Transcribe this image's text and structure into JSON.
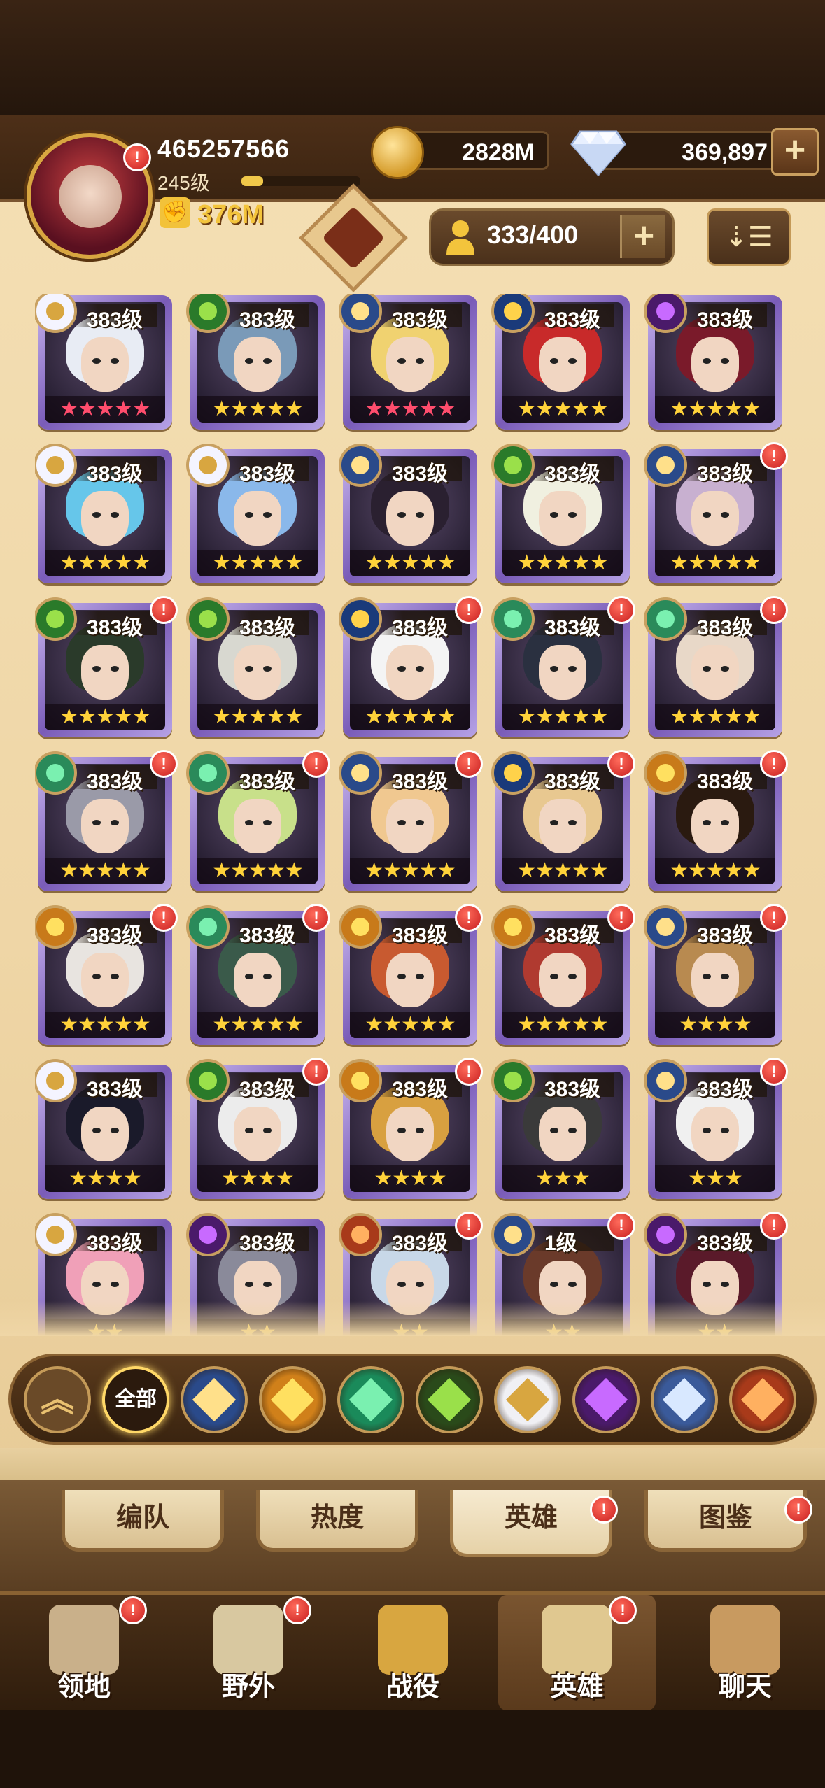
{
  "player": {
    "id": "465257566",
    "level": "245级",
    "xp_progress": 0.18,
    "power": "376M",
    "avatar_badge": "!"
  },
  "currency": {
    "gold": "2828M",
    "diamonds": "369,897",
    "add_symbol": "+"
  },
  "heroes_count": "333/400",
  "sort_symbol": "⇣☰",
  "colors": {
    "frame_purple": "#7a5cb8",
    "gold": "#f3c43c",
    "red_badge": "#d62828",
    "panel": "#f0dab0"
  },
  "heroes": [
    {
      "level": "383级",
      "stars": "★★★★★",
      "star_color": "#ff4d6d",
      "faction": "celestial",
      "badge": "",
      "hair": "#e8ecf4"
    },
    {
      "level": "383级",
      "stars": "★★★★★",
      "star_color": "#ffd23a",
      "faction": "wilder-eye",
      "badge": "",
      "hair": "#7a9ab8"
    },
    {
      "level": "383级",
      "stars": "★★★★★",
      "star_color": "#ff4d6d",
      "faction": "lightbearer",
      "badge": "",
      "hair": "#f0d270"
    },
    {
      "level": "383级",
      "stars": "★★★★★",
      "star_color": "#ffd23a",
      "faction": "lightbearer-star",
      "badge": "",
      "hair": "#c82a2a"
    },
    {
      "level": "383级",
      "stars": "★★★★★",
      "star_color": "#ffd23a",
      "faction": "hypogean",
      "badge": "",
      "hair": "#7a1a2a"
    },
    {
      "level": "383级",
      "stars": "★★★★★",
      "star_color": "#ffd23a",
      "faction": "celestial",
      "badge": "",
      "hair": "#66c6ea"
    },
    {
      "level": "383级",
      "stars": "★★★★★",
      "star_color": "#ffd23a",
      "faction": "celestial",
      "badge": "",
      "hair": "#8ab8ea"
    },
    {
      "level": "383级",
      "stars": "★★★★★",
      "star_color": "#ffd23a",
      "faction": "lightbearer",
      "badge": "",
      "hair": "#2a2030"
    },
    {
      "level": "383级",
      "stars": "★★★★★",
      "star_color": "#ffd23a",
      "faction": "wilder-eye",
      "badge": "",
      "hair": "#f0f0e0"
    },
    {
      "level": "383级",
      "stars": "★★★★★",
      "star_color": "#ffd23a",
      "faction": "lightbearer",
      "badge": "!",
      "hair": "#c8b0d0"
    },
    {
      "level": "383级",
      "stars": "★★★★★",
      "star_color": "#ffd23a",
      "faction": "wilder-eye",
      "badge": "!",
      "hair": "#2a3a2a"
    },
    {
      "level": "383级",
      "stars": "★★★★★",
      "star_color": "#ffd23a",
      "faction": "wilder-eye",
      "badge": "",
      "hair": "#d8d8d0"
    },
    {
      "level": "383级",
      "stars": "★★★★★",
      "star_color": "#ffd23a",
      "faction": "lightbearer-star",
      "badge": "!",
      "hair": "#f4f4f4"
    },
    {
      "level": "383级",
      "stars": "★★★★★",
      "star_color": "#ffd23a",
      "faction": "wilder",
      "badge": "!",
      "hair": "#2a3040"
    },
    {
      "level": "383级",
      "stars": "★★★★★",
      "star_color": "#ffd23a",
      "faction": "wilder",
      "badge": "!",
      "hair": "#e8d8c8"
    },
    {
      "level": "383级",
      "stars": "★★★★★",
      "star_color": "#ffd23a",
      "faction": "wilder",
      "badge": "!",
      "hair": "#9a9aa8"
    },
    {
      "level": "383级",
      "stars": "★★★★★",
      "star_color": "#ffd23a",
      "faction": "wilder",
      "badge": "!",
      "hair": "#c8e08a"
    },
    {
      "level": "383级",
      "stars": "★★★★★",
      "star_color": "#ffd23a",
      "faction": "lightbearer",
      "badge": "!",
      "hair": "#f0c890"
    },
    {
      "level": "383级",
      "stars": "★★★★★",
      "star_color": "#ffd23a",
      "faction": "lightbearer-star",
      "badge": "!",
      "hair": "#e8c890"
    },
    {
      "level": "383级",
      "stars": "★★★★★",
      "star_color": "#ffd23a",
      "faction": "mauler",
      "badge": "!",
      "hair": "#2a1a10"
    },
    {
      "level": "383级",
      "stars": "★★★★★",
      "star_color": "#ffd23a",
      "faction": "mauler",
      "badge": "!",
      "hair": "#e8e4e0"
    },
    {
      "level": "383级",
      "stars": "★★★★★",
      "star_color": "#ffd23a",
      "faction": "wilder",
      "badge": "!",
      "hair": "#3a5a4a"
    },
    {
      "level": "383级",
      "stars": "★★★★★",
      "star_color": "#ffd23a",
      "faction": "mauler",
      "badge": "!",
      "hair": "#c85a30"
    },
    {
      "level": "383级",
      "stars": "★★★★★",
      "star_color": "#ffd23a",
      "faction": "mauler",
      "badge": "!",
      "hair": "#b03a30"
    },
    {
      "level": "383级",
      "stars": "★★★★",
      "star_color": "#ffd23a",
      "faction": "lightbearer",
      "badge": "!",
      "hair": "#b88a50"
    },
    {
      "level": "383级",
      "stars": "★★★★",
      "star_color": "#ffd23a",
      "faction": "celestial",
      "badge": "",
      "hair": "#1a1a2a"
    },
    {
      "level": "383级",
      "stars": "★★★★",
      "star_color": "#ffd23a",
      "faction": "wilder-eye",
      "badge": "!",
      "hair": "#ececec"
    },
    {
      "level": "383级",
      "stars": "★★★★",
      "star_color": "#ffd23a",
      "faction": "mauler",
      "badge": "!",
      "hair": "#d8a040"
    },
    {
      "level": "383级",
      "stars": "★★★",
      "star_color": "#ffd23a",
      "faction": "wilder-eye",
      "badge": "",
      "hair": "#3a3a3a"
    },
    {
      "level": "383级",
      "stars": "★★★",
      "star_color": "#ffd23a",
      "faction": "lightbearer",
      "badge": "!",
      "hair": "#f0f0f0"
    },
    {
      "level": "383级",
      "stars": "★★",
      "star_color": "#ffd23a",
      "faction": "celestial",
      "badge": "",
      "hair": "#f0a0b8"
    },
    {
      "level": "383级",
      "stars": "★★",
      "star_color": "#ffd23a",
      "faction": "hypogean",
      "badge": "",
      "hair": "#8a8a9a"
    },
    {
      "level": "383级",
      "stars": "★★",
      "star_color": "#ffd23a",
      "faction": "dimensional",
      "badge": "!",
      "hair": "#c8d8e8"
    },
    {
      "level": "1级",
      "stars": "★★",
      "star_color": "#ffd23a",
      "faction": "lightbearer",
      "badge": "!",
      "hair": "#6a3a2a"
    },
    {
      "level": "383级",
      "stars": "★★",
      "star_color": "#ffd23a",
      "faction": "hypogean",
      "badge": "!",
      "hair": "#5a1a2a"
    }
  ],
  "filters": [
    {
      "name": "collapse",
      "label": ""
    },
    {
      "name": "all",
      "label": "全部"
    },
    {
      "name": "lightbearer",
      "label": ""
    },
    {
      "name": "mauler",
      "label": ""
    },
    {
      "name": "wilder",
      "label": ""
    },
    {
      "name": "graveborn",
      "label": ""
    },
    {
      "name": "celestial",
      "label": ""
    },
    {
      "name": "hypogean",
      "label": ""
    },
    {
      "name": "dimensional",
      "label": ""
    },
    {
      "name": "dragon",
      "label": ""
    }
  ],
  "tabs": [
    {
      "label": "编队",
      "badge": ""
    },
    {
      "label": "热度",
      "badge": ""
    },
    {
      "label": "英雄",
      "badge": "!"
    },
    {
      "label": "图鉴",
      "badge": "!"
    }
  ],
  "nav": [
    {
      "label": "领地",
      "badge": "!"
    },
    {
      "label": "野外",
      "badge": "!"
    },
    {
      "label": "战役",
      "badge": ""
    },
    {
      "label": "英雄",
      "badge": "!"
    },
    {
      "label": "聊天",
      "badge": ""
    }
  ]
}
